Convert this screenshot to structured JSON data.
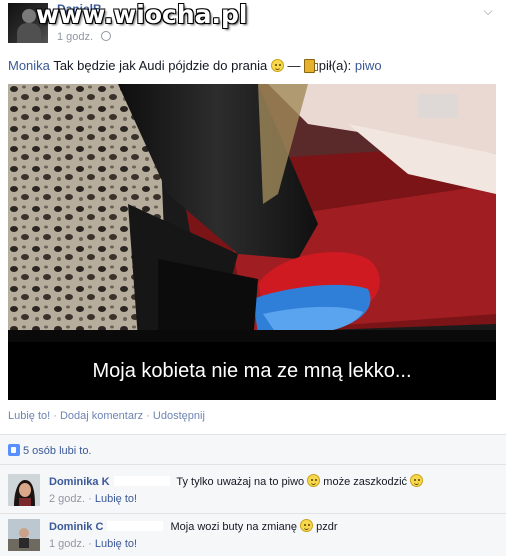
{
  "post": {
    "author": "DanielB",
    "time": "1 godz.",
    "watermark": "www.wiocha.pl",
    "status": {
      "tagged": "Monika",
      "text": "Tak będzie jak Audi pójdzie do prania",
      "dash": "—",
      "activity_label": "pił(a):",
      "activity_object": "piwo"
    },
    "caption": "Moja kobieta nie ma ze mną lekko...",
    "actions": {
      "like": "Lubię to!",
      "sep1": " · ",
      "comment": "Dodaj komentarz",
      "sep2": " · ",
      "share": "Udostępnij"
    },
    "likes": "5 osób lubi to.",
    "comments": [
      {
        "name": "Dominika K",
        "text": "Ty tylko uważaj na to piwo",
        "text_after": "może zaszkodzić",
        "time": "2 godz.",
        "like": "Lubię to!"
      },
      {
        "name": "Dominik C",
        "text": "Moja wozi buty na zmianę",
        "text_after": "pzdr",
        "time": "1 godz.",
        "like": "Lubię to!"
      }
    ]
  },
  "colors": {
    "link": "#3b5998",
    "meta": "#9197a3",
    "ufi_bg": "#f6f7f9"
  },
  "icons": [
    "globe-icon",
    "chevron-down-icon",
    "smile-icon",
    "beer-icon",
    "like-icon",
    "grin-icon"
  ]
}
